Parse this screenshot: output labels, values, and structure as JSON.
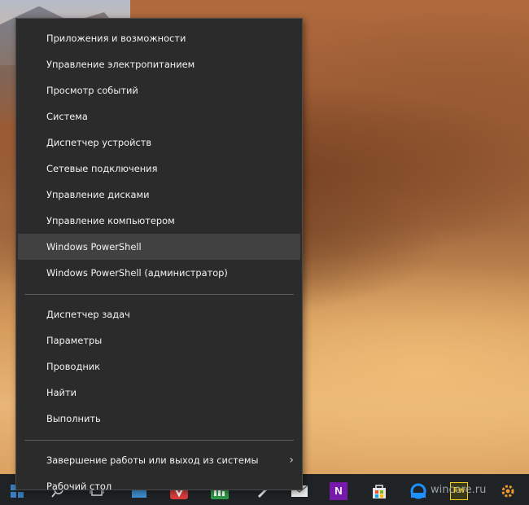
{
  "menu": {
    "group1": [
      "Приложения и возможности",
      "Управление электропитанием",
      "Просмотр событий",
      "Система",
      "Диспетчер устройств",
      "Сетевые подключения",
      "Управление дисками",
      "Управление компьютером",
      "Windows PowerShell",
      "Windows PowerShell (администратор)"
    ],
    "group2": [
      "Диспетчер задач",
      "Параметры",
      "Проводник",
      "Найти",
      "Выполнить"
    ],
    "group3": {
      "shutdown": "Завершение работы или выход из системы",
      "desktop": "Рабочий стол"
    },
    "hovered_item": "Windows PowerShell"
  },
  "taskbar": {
    "icons": [
      "windows-icon",
      "search-icon",
      "task-view-icon",
      "store-bag-icon",
      "vivaldi-icon",
      "green-app-icon",
      "pen-icon",
      "mail-icon",
      "onenote-icon",
      "microsoft-store-icon",
      "ie-beta-icon",
      "fireworks-icon",
      "settings-gear-icon"
    ],
    "onenote_label": "N",
    "fireworks_label": "Fw",
    "ie_badge": "BETA"
  },
  "watermark": "wincore.ru",
  "colors": {
    "menu_bg": "#2b2b2b",
    "menu_hover": "#414141",
    "menu_text": "#f2f2f2",
    "taskbar_bg": "#1f2326",
    "onenote": "#7719aa",
    "fireworks": "#f7d117"
  }
}
